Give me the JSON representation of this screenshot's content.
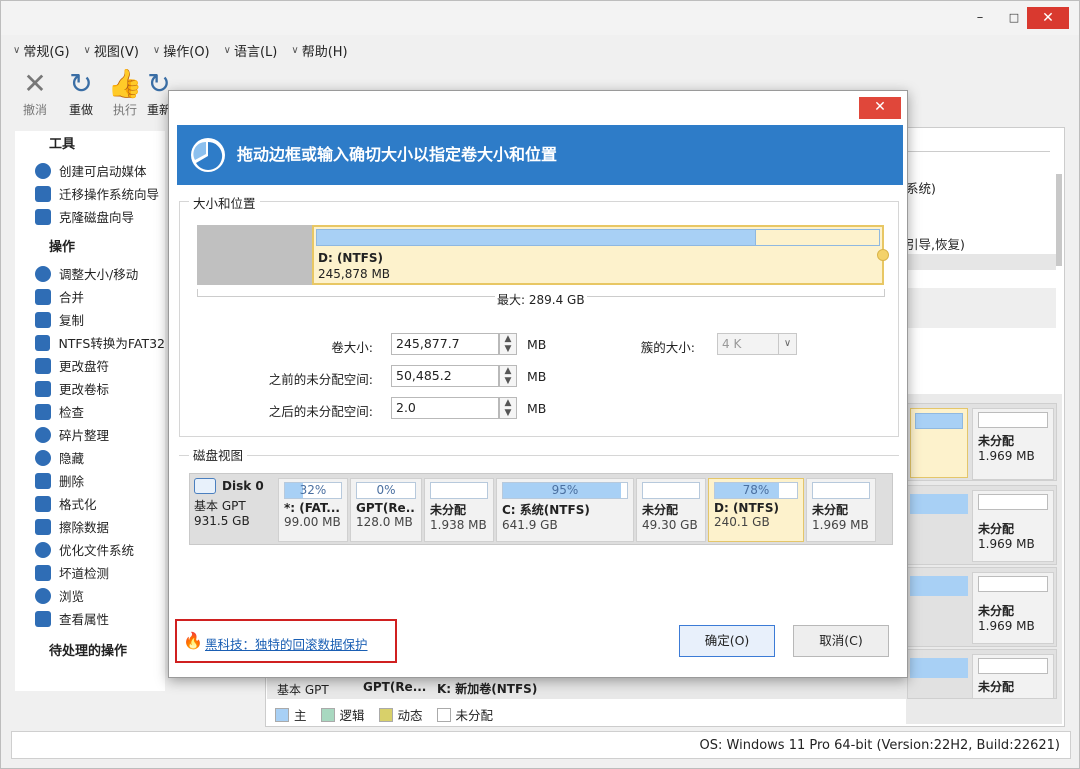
{
  "window": {
    "minimize": "–",
    "maximize": "□",
    "close": "✕"
  },
  "menu": [
    {
      "label": "常规(G)"
    },
    {
      "label": "视图(V)"
    },
    {
      "label": "操作(O)"
    },
    {
      "label": "语言(L)"
    },
    {
      "label": "帮助(H)"
    }
  ],
  "toolbar": {
    "undo": "撤消",
    "redo": "重做",
    "execute": "执行",
    "more": "重新"
  },
  "sidebar": {
    "tools_title": "工具",
    "tools": [
      "创建可启动媒体",
      "迁移操作系统向导",
      "克隆磁盘向导"
    ],
    "ops_title": "操作",
    "ops": [
      "调整大小/移动",
      "合并",
      "复制",
      "NTFS转换为FAT32",
      "更改盘符",
      "更改卷标",
      "检查",
      "碎片整理",
      "隐藏",
      "删除",
      "格式化",
      "擦除数据",
      "优化文件系统",
      "坏道检测",
      "浏览",
      "查看属性"
    ],
    "pending_title": "待处理的操作"
  },
  "colors": {
    "primary": "#2e7cc8",
    "close": "#d9392f",
    "partition_fill": "#a8d0f5",
    "selected": "#fdf2cc"
  },
  "background": {
    "frag1": "系统)",
    "frag2": "引导,恢复)",
    "cards": [
      {
        "name": "未分配",
        "size": "1.969 MB"
      },
      {
        "name": "未分配",
        "size": "1.969 MB"
      },
      {
        "name": "未分配",
        "size": "1.969 MB"
      },
      {
        "name": "未分配",
        "size": ""
      }
    ],
    "bottom_row": {
      "type": "基本 GPT",
      "part1": "GPT(Re...",
      "part2": "K: 新加卷(NTFS)"
    }
  },
  "legend": [
    {
      "label": "主",
      "color": "#a8d0f5"
    },
    {
      "label": "逻辑",
      "color": "#a8d8c0"
    },
    {
      "label": "动态",
      "color": "#d8d06a"
    },
    {
      "label": "未分配",
      "color": "#ffffff"
    }
  ],
  "status": "OS: Windows 11 Pro 64-bit (Version:22H2, Build:22621)",
  "dialog": {
    "close": "✕",
    "heading": "拖动边框或输入确切大小以指定卷大小和位置",
    "group_size": "大小和位置",
    "volume_name": "D: (NTFS)",
    "volume_size": "245,878 MB",
    "max_label": "最大: 289.4 GB",
    "used_fraction": 0.78,
    "fields": {
      "vol_size_label": "卷大小:",
      "vol_size": "245,877.7",
      "before_label": "之前的未分配空间:",
      "before": "50,485.2",
      "after_label": "之后的未分配空间:",
      "after": "2.0",
      "unit": "MB",
      "cluster_label": "簇的大小:",
      "cluster": "4 K"
    },
    "group_disk": "磁盘视图",
    "disk": {
      "name": "Disk 0",
      "type": "基本 GPT",
      "size": "931.5 GB"
    },
    "partitions": [
      {
        "pct": "32%",
        "name": "*: (FAT...",
        "size": "99.00 MB",
        "fill": 0.32
      },
      {
        "pct": "0%",
        "name": "GPT(Re...",
        "size": "128.0 MB",
        "fill": 0
      },
      {
        "pct": "",
        "name": "未分配",
        "size": "1.938 MB",
        "fill": 0
      },
      {
        "pct": "95%",
        "name": "C: 系统(NTFS)",
        "size": "641.9 GB",
        "fill": 0.95
      },
      {
        "pct": "",
        "name": "未分配",
        "size": "49.30 GB",
        "fill": 0
      },
      {
        "pct": "78%",
        "name": "D: (NTFS)",
        "size": "240.1 GB",
        "fill": 0.78
      },
      {
        "pct": "",
        "name": "未分配",
        "size": "1.969 MB",
        "fill": 0
      }
    ],
    "tip": "黑科技：独特的回滚数据保护",
    "ok": "确定(O)",
    "cancel": "取消(C)"
  }
}
